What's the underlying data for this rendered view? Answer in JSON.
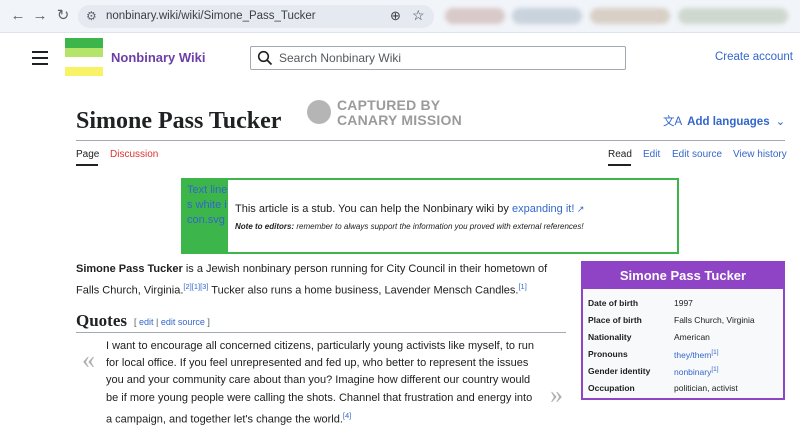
{
  "browser": {
    "url": "nonbinary.wiki/wiki/Simone_Pass_Tucker",
    "back_icon": "←",
    "forward_icon": "→",
    "reload_icon": "↻",
    "site_info_icon": "⚙",
    "zoom_icon": "⊕",
    "star_icon": "☆"
  },
  "header": {
    "site_name": "Nonbinary Wiki",
    "search_placeholder": "Search Nonbinary Wiki",
    "create_account": "Create account",
    "logo_colors": [
      "#3cb64a",
      "#b5e46b",
      "#ffffff",
      "#f7f266"
    ]
  },
  "title": {
    "text": "Simone Pass Tucker",
    "watermark_line1": "CAPTURED BY",
    "watermark_line2": "CANARY MISSION",
    "add_languages": "Add languages"
  },
  "tabs": {
    "page": "Page",
    "discussion": "Discussion",
    "read": "Read",
    "edit": "Edit",
    "edit_source": "Edit source",
    "view_history": "View history"
  },
  "stub": {
    "image_alt": "Text lines white icon.svg",
    "text": "This article is a stub. You can help the Nonbinary wiki by",
    "link": "expanding it!",
    "note_label": "Note to editors:",
    "note_text": "remember to always support the information you proved with external references!",
    "border_color": "#3cb64a"
  },
  "lead": {
    "subject": "Simone Pass Tucker",
    "text_1": " is a Jewish nonbinary person running for City Council in their hometown of Falls Church, Virginia.",
    "refs_1": [
      "[2]",
      "[1]",
      "[3]"
    ],
    "text_2": " Tucker also runs a home business, Lavender Mensch Candles.",
    "refs_2": [
      "[1]"
    ]
  },
  "quotes": {
    "heading": "Quotes",
    "edit": "edit",
    "edit_source": "edit source",
    "open_mark": "«",
    "close_mark": "»",
    "text": "I want to encourage all concerned citizens, particularly young activists like myself, to run for local office. If you feel unrepresented and fed up, who better to represent the issues you and your community care about than you? Imagine how different our country would be if more young people were calling the shots. Channel that frustration and energy into a campaign, and together let's change the world.",
    "ref": "[4]"
  },
  "infobox": {
    "title": "Simone Pass Tucker",
    "accent": "#8e44c4",
    "rows": [
      {
        "label": "Date of birth",
        "value": "1997"
      },
      {
        "label": "Place of birth",
        "value": "Falls Church, Virginia"
      },
      {
        "label": "Nationality",
        "value": "American"
      },
      {
        "label": "Pronouns",
        "value": "they/them",
        "ref": "[1]"
      },
      {
        "label": "Gender identity",
        "value": "nonbinary",
        "ref": "[1]"
      },
      {
        "label": "Occupation",
        "value": "politician, activist"
      }
    ]
  }
}
